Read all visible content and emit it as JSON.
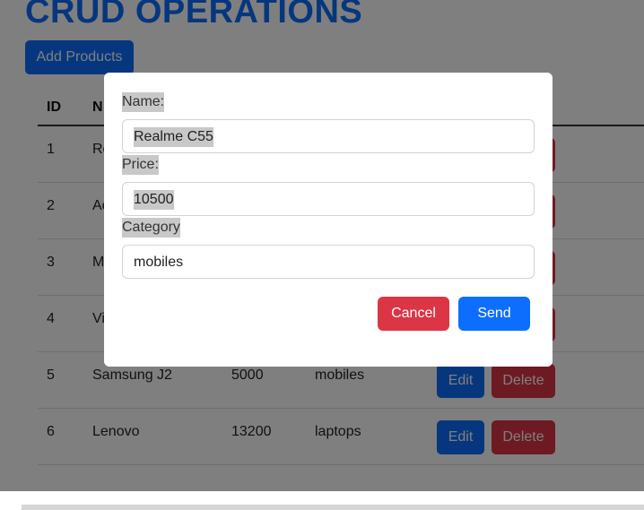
{
  "page": {
    "title": "CRUD OPERATIONS",
    "add_button_label": "Add Products"
  },
  "table": {
    "headers": [
      "ID",
      "N"
    ],
    "rows": [
      {
        "id": "1",
        "name": "Re",
        "price": "",
        "category": ""
      },
      {
        "id": "2",
        "name": "Ac",
        "price": "",
        "category": ""
      },
      {
        "id": "3",
        "name": "M",
        "price": "",
        "category": ""
      },
      {
        "id": "4",
        "name": "Vi",
        "price": "",
        "category": ""
      },
      {
        "id": "5",
        "name": "Samsung J2",
        "price": "5000",
        "category": "mobiles"
      },
      {
        "id": "6",
        "name": "Lenovo",
        "price": "13200",
        "category": "laptops"
      }
    ],
    "edit_label": "Edit",
    "delete_label": "Delete"
  },
  "modal": {
    "name_label": "Name:",
    "name_value": "Realme C55",
    "price_label": "Price:",
    "price_value": "10500",
    "category_label": "Category",
    "category_value": "mobiles",
    "cancel_label": "Cancel",
    "send_label": "Send"
  },
  "colors": {
    "primary": "#0d6efd",
    "danger": "#dc3545",
    "overlay": "rgba(0,0,0,0.5)",
    "selection": "#c8c8c8"
  }
}
